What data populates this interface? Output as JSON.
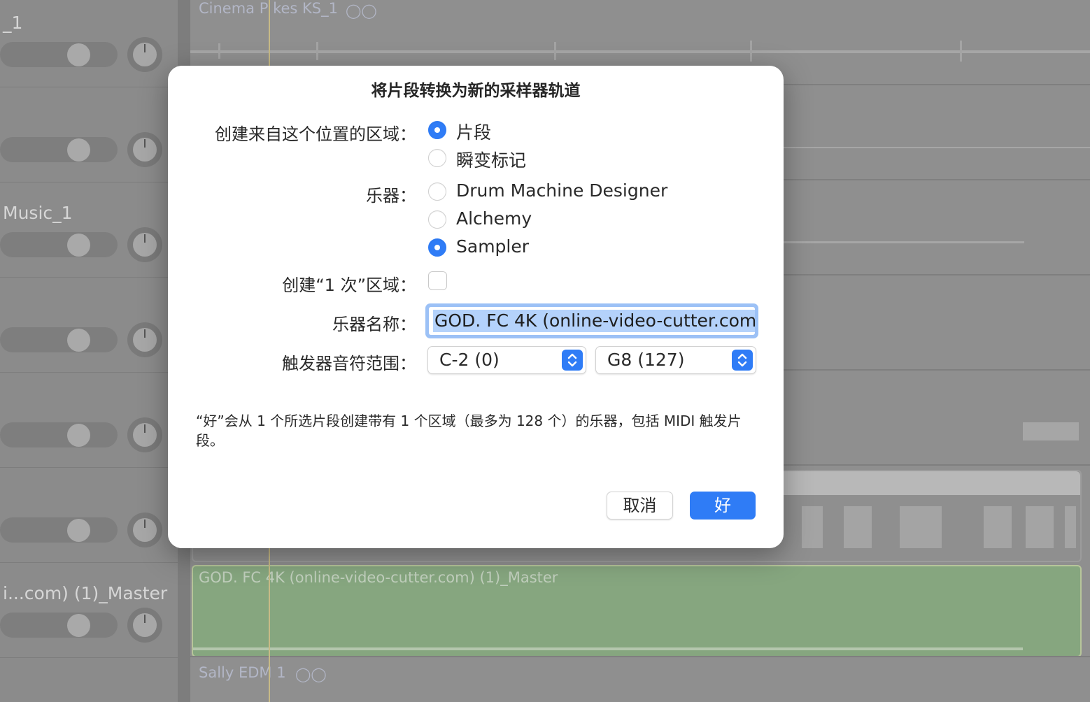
{
  "background": {
    "tracks": [
      {
        "name": "_1"
      },
      {
        "name": ""
      },
      {
        "name": "Music_1"
      },
      {
        "name": ""
      },
      {
        "name": ""
      },
      {
        "name": ""
      },
      {
        "name": "i...com) (1)_Master"
      }
    ],
    "regions": {
      "top": "Cinema P  kes KS_1",
      "green": "GOD. FC  4K (online-video-cutter.com) (1)_Master",
      "bottom": "Sally EDM  1"
    }
  },
  "dialog": {
    "title": "将片段转换为新的采样器轨道",
    "create_from_label": "创建来自这个位置的区域：",
    "create_from_options": [
      {
        "label": "片段",
        "checked": true
      },
      {
        "label": "瞬变标记",
        "checked": false
      }
    ],
    "instrument_label": "乐器：",
    "instrument_options": [
      {
        "label": "Drum Machine Designer",
        "checked": false
      },
      {
        "label": "Alchemy",
        "checked": false
      },
      {
        "label": "Sampler",
        "checked": true
      }
    ],
    "one_shot_label": "创建“1 次”区域：",
    "one_shot_checked": false,
    "instrument_name_label": "乐器名称：",
    "instrument_name_value": "GOD. FC 4K (online-video-cutter.com",
    "trigger_range_label": "触发器音符范围：",
    "trigger_low": "C-2  (0)",
    "trigger_high": "G8   (127)",
    "note": "“好”会从 1 个所选片段创建带有 1 个区域（最多为 128 个）的乐器，包括 MIDI 触发片段。",
    "cancel_label": "取消",
    "ok_label": "好"
  },
  "colors": {
    "accent": "#2f7cf6",
    "green_region": "#86a67f"
  }
}
